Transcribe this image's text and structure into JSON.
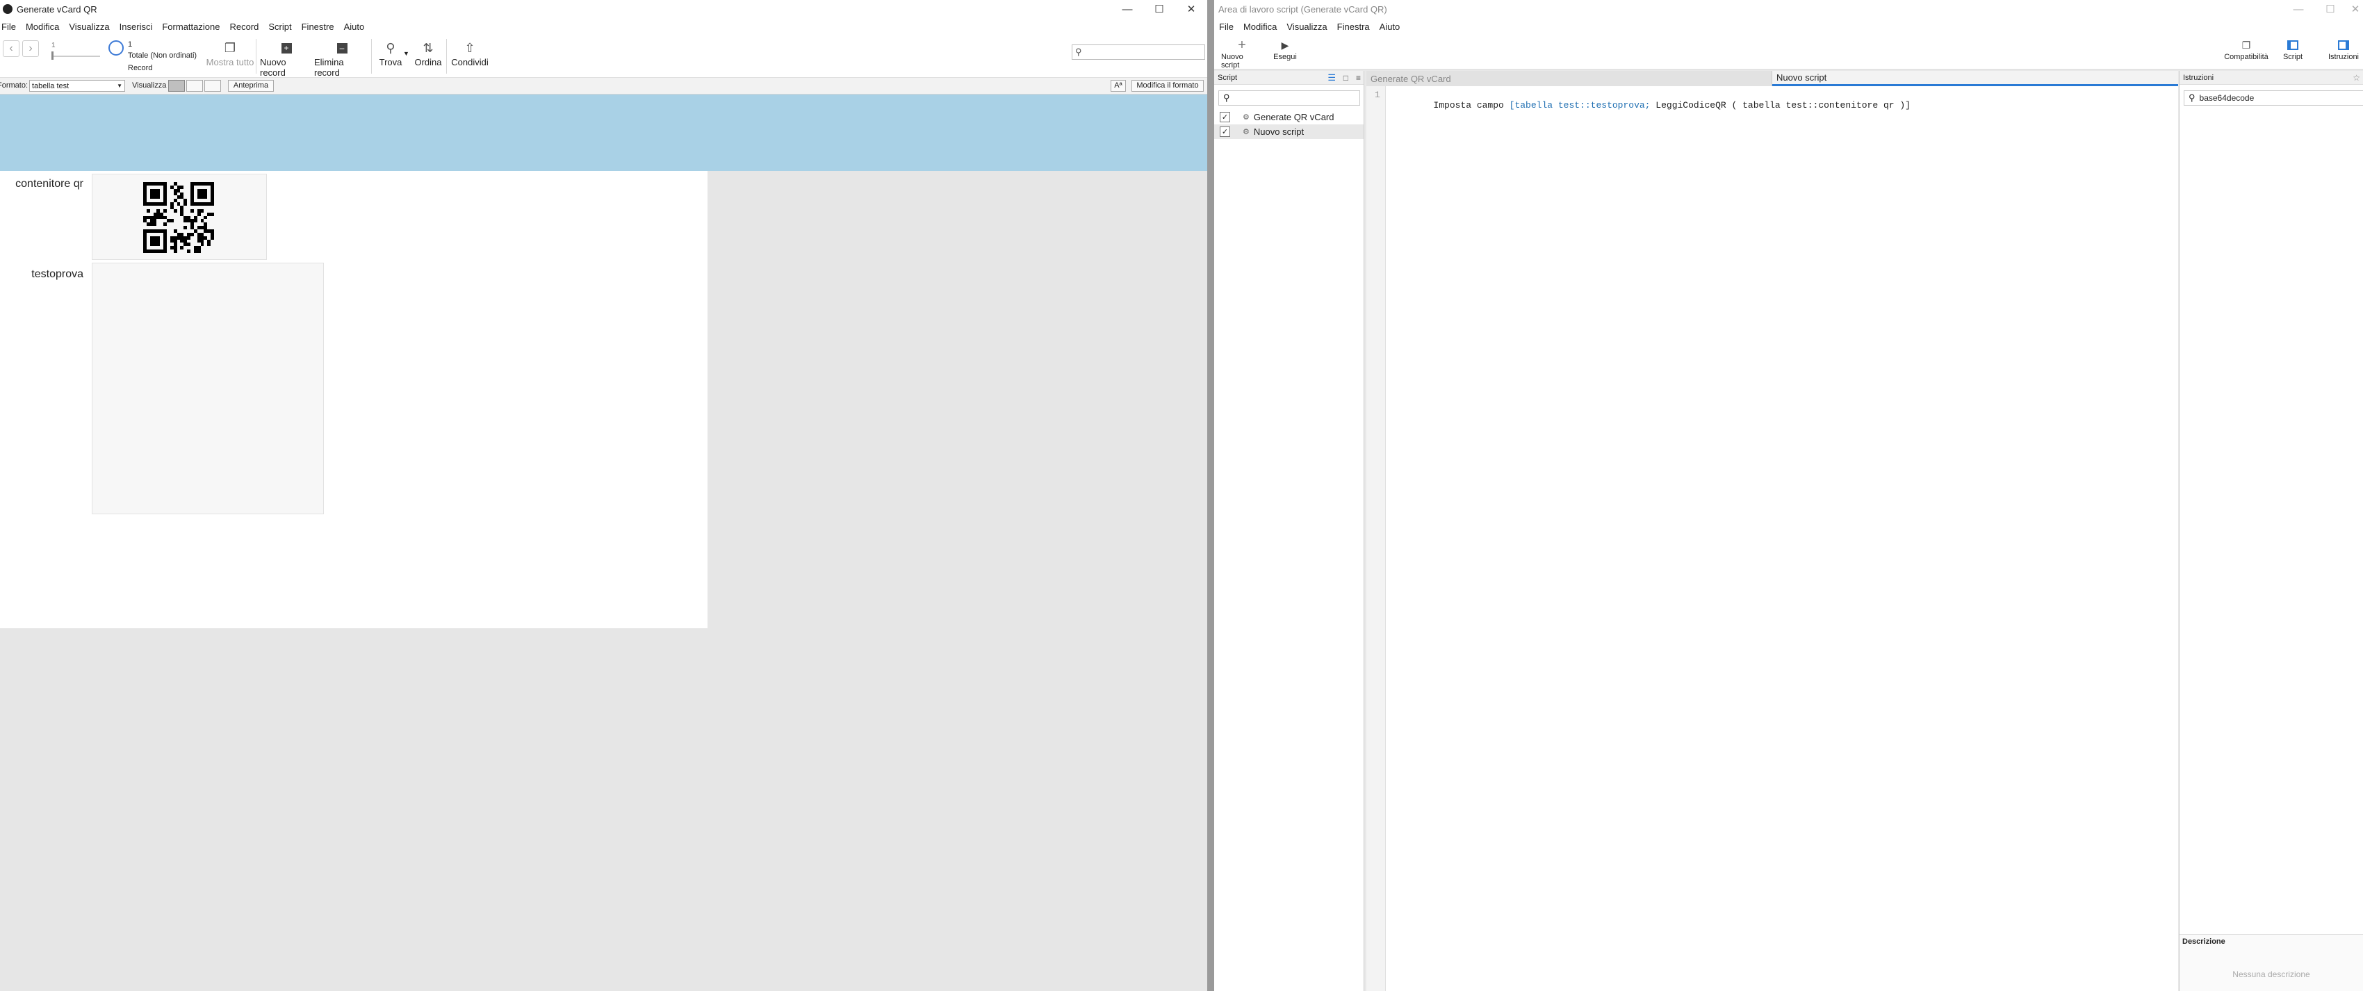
{
  "left_window": {
    "title": "Generate vCard QR",
    "menu": [
      "File",
      "Modifica",
      "Visualizza",
      "Inserisci",
      "Formattazione",
      "Record",
      "Script",
      "Finestre",
      "Aiuto"
    ],
    "toolbar": {
      "record_number": "1",
      "total_count": "1",
      "total_label": "Totale (Non ordinati)",
      "record_label": "Record",
      "show_all": "Mostra tutto",
      "new_record": "Nuovo record",
      "delete_record": "Elimina record",
      "find": "Trova",
      "sort": "Ordina",
      "share": "Condividi",
      "search_placeholder": ""
    },
    "formatbar": {
      "layout_label": "Formato:",
      "layout_value": "tabella test",
      "view_label": "Visualizza",
      "preview": "Anteprima",
      "aa": "Aª",
      "edit_layout": "Modifica il formato"
    },
    "fields": [
      {
        "label": "contenitore qr"
      },
      {
        "label": "testoprova"
      }
    ]
  },
  "right_window": {
    "title": "Area di lavoro script (Generate vCard QR)",
    "menu": [
      "File",
      "Modifica",
      "Visualizza",
      "Finestra",
      "Aiuto"
    ],
    "toolbar": {
      "new_script": "Nuovo script",
      "run": "Esegui",
      "compatibility": "Compatibilità",
      "script": "Script",
      "steps": "Istruzioni"
    },
    "scripts_panel": {
      "title": "Script",
      "items": [
        "Generate QR vCard",
        "Nuovo script"
      ]
    },
    "tabs": [
      "Generate QR vCard",
      "Nuovo script"
    ],
    "editor": {
      "line_number": "1",
      "code_prefix": "Imposta campo ",
      "code_target": "[tabella test::testoprova;",
      "code_rest": " LeggiCodiceQR ( tabella test::contenitore qr )]"
    },
    "steps_panel": {
      "title": "Istruzioni",
      "search_value": "base64decode",
      "description_title": "Descrizione",
      "description_placeholder": "Nessuna descrizione"
    }
  },
  "colors": {
    "header_band": "#a9d1e6",
    "code_target": "#1f6fb2",
    "active_tab_line": "#2a7ad5"
  }
}
